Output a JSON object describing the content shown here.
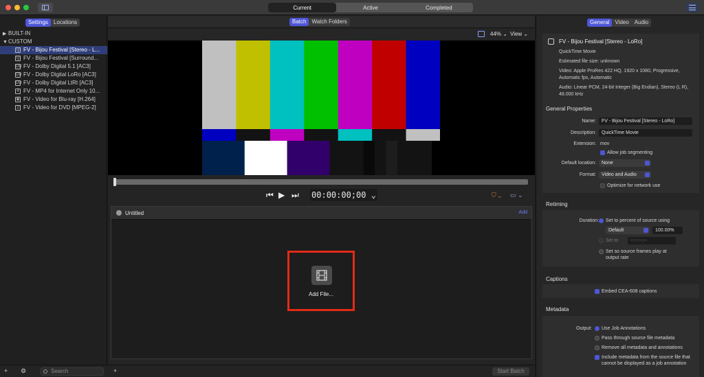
{
  "window": {
    "top_tabs": [
      "Current",
      "Active",
      "Completed"
    ],
    "active_tab": "Current"
  },
  "sidebar": {
    "tabs": [
      "Settings",
      "Locations"
    ],
    "active_tab": "Settings",
    "groups": [
      {
        "label": "BUILT-IN",
        "expanded": false
      },
      {
        "label": "CUSTOM",
        "expanded": true
      }
    ],
    "items": [
      {
        "label": "FV - Bijou Festival [Stereo - L...",
        "icon": "quicktime-icon",
        "glyph": "Q",
        "selected": true
      },
      {
        "label": "FV - Bijou Festival [Surround...",
        "icon": "quicktime-icon",
        "glyph": "Q",
        "selected": false
      },
      {
        "label": "FV - Dolby Digital 5.1 [AC3]",
        "icon": "dolby-icon",
        "glyph": "DD",
        "selected": false
      },
      {
        "label": "FV - Dolby Digital LoRo [AC3]",
        "icon": "dolby-icon",
        "glyph": "DD",
        "selected": false
      },
      {
        "label": "FV - Dolby Digital LtRt [AC3]",
        "icon": "dolby-icon",
        "glyph": "DD",
        "selected": false
      },
      {
        "label": "FV - MP4 for Internet Only 10...",
        "icon": "mp4-icon",
        "glyph": "4",
        "selected": false
      },
      {
        "label": "FV - Video for Blu-ray [H.264]",
        "icon": "bluray-icon",
        "glyph": "◉",
        "selected": false
      },
      {
        "label": "FV - Video for DVD [MPEG-2]",
        "icon": "dvd-icon",
        "glyph": "2",
        "selected": false
      }
    ],
    "search_placeholder": "Search",
    "footer_add": "+",
    "footer_gear": "⚙"
  },
  "center": {
    "tabs": [
      "Batch",
      "Watch Folders"
    ],
    "active_tab": "Batch",
    "zoom": "44%",
    "view_menu": "View",
    "timecode": "00:00:00;00",
    "batch_title": "Untitled",
    "batch_add": "Add",
    "add_file_label": "Add File...",
    "start_batch": "Start Batch",
    "footer_add": "+"
  },
  "colorbars": {
    "top": [
      "#c0c0c0",
      "#c0c000",
      "#00c0c0",
      "#00c000",
      "#c000c0",
      "#c00000",
      "#0000c0"
    ],
    "middle": [
      "#0000c0",
      "#131313",
      "#c000c0",
      "#131313",
      "#00c0c0",
      "#131313",
      "#c0c0c0"
    ],
    "bottom": [
      "#00214c",
      "#ffffff",
      "#32006a",
      "#131313",
      "#090909",
      "#131313",
      "#1d1d1d",
      "#131313"
    ]
  },
  "inspector": {
    "tabs": [
      "General",
      "Video",
      "Audio"
    ],
    "active_tab": "General",
    "summary": {
      "title": "FV - Bijou Festival [Stereo - LoRo]",
      "type": "QuickTime Movie",
      "size": "Estimated file size: unknown",
      "video": "Video: Apple ProRes 422 HQ, 1920 x 1080, Progressive, Automatic fps, Automatic",
      "audio": "Audio: Linear PCM, 24-bit Integer (Big Endian), Stereo (L R), 48.000 kHz"
    },
    "general": {
      "heading": "General Properties",
      "name_label": "Name:",
      "name_value": "FV - Bijou Festival [Stereo - LoRo]",
      "desc_label": "Description:",
      "desc_value": "QuickTime Movie",
      "ext_label": "Extension:",
      "ext_value": "mov",
      "segmenting": "Allow job segmenting",
      "location_label": "Default location:",
      "location_value": "None",
      "format_label": "Format:",
      "format_value": "Video and Audio",
      "optimize": "Optimize for network use"
    },
    "retiming": {
      "heading": "Retiming",
      "duration_label": "Duration:",
      "opt_percent": "Set to percent of source using",
      "default_popup": "Default",
      "percent": "100.00%",
      "opt_setto": "Set to",
      "setto_value": "--:--:--;--",
      "opt_frames": "Set so source frames play at output rate"
    },
    "captions": {
      "heading": "Captions",
      "embed": "Embed CEA-608 captions"
    },
    "metadata": {
      "heading": "Metadata",
      "output_label": "Output:",
      "opt_annotations": "Use Job Annotations",
      "opt_passthrough": "Pass through source file metadata",
      "opt_remove": "Remove all metadata and annotations",
      "include": "Include metadata from the source file that cannot be displayed as a job annotation"
    }
  }
}
